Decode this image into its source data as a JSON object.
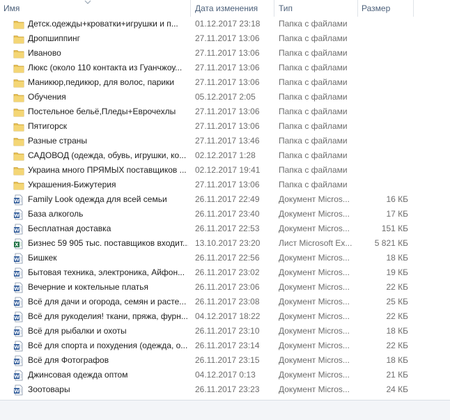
{
  "columns": {
    "name": "Имя",
    "date": "Дата изменения",
    "type": "Тип",
    "size": "Размер"
  },
  "rows": [
    {
      "name": "Детск.одежды+кроватки+игрушки и п...",
      "date": "01.12.2017 23:18",
      "type": "Папка с файлами",
      "size": "",
      "icon": "folder-icon"
    },
    {
      "name": "Дропшиппинг",
      "date": "27.11.2017 13:06",
      "type": "Папка с файлами",
      "size": "",
      "icon": "folder-icon"
    },
    {
      "name": "Иваново",
      "date": "27.11.2017 13:06",
      "type": "Папка с файлами",
      "size": "",
      "icon": "folder-icon"
    },
    {
      "name": "Люкс (около 110 контакта из Гуанчжоу...",
      "date": "27.11.2017 13:06",
      "type": "Папка с файлами",
      "size": "",
      "icon": "folder-icon"
    },
    {
      "name": "Маникюр,педикюр, для волос, парики",
      "date": "27.11.2017 13:06",
      "type": "Папка с файлами",
      "size": "",
      "icon": "folder-icon"
    },
    {
      "name": "Обучения",
      "date": "05.12.2017 2:05",
      "type": "Папка с файлами",
      "size": "",
      "icon": "folder-icon"
    },
    {
      "name": "Постельное бельё,Пледы+Еврочехлы",
      "date": "27.11.2017 13:06",
      "type": "Папка с файлами",
      "size": "",
      "icon": "folder-icon"
    },
    {
      "name": "Пятигорск",
      "date": "27.11.2017 13:06",
      "type": "Папка с файлами",
      "size": "",
      "icon": "folder-icon"
    },
    {
      "name": "Разные страны",
      "date": "27.11.2017 13:46",
      "type": "Папка с файлами",
      "size": "",
      "icon": "folder-icon"
    },
    {
      "name": "САДОВОД (одежда, обувь, игрушки, ко...",
      "date": "02.12.2017 1:28",
      "type": "Папка с файлами",
      "size": "",
      "icon": "folder-icon"
    },
    {
      "name": "Украина много ПРЯМЫХ поставщиков ...",
      "date": "02.12.2017 19:41",
      "type": "Папка с файлами",
      "size": "",
      "icon": "folder-icon"
    },
    {
      "name": "Украшения-Бижутерия",
      "date": "27.11.2017 13:06",
      "type": "Папка с файлами",
      "size": "",
      "icon": "folder-icon"
    },
    {
      "name": "Family Look  одежда для всей семьи",
      "date": "26.11.2017 22:49",
      "type": "Документ Micros...",
      "size": "16 КБ",
      "icon": "word-doc-icon"
    },
    {
      "name": "База алкоголь",
      "date": "26.11.2017 23:40",
      "type": "Документ Micros...",
      "size": "17 КБ",
      "icon": "word-doc-icon"
    },
    {
      "name": "Бесплатная доставка",
      "date": "26.11.2017 22:53",
      "type": "Документ Micros...",
      "size": "151 КБ",
      "icon": "word-doc-icon"
    },
    {
      "name": "Бизнес 59 905 тыс. поставщиков входит...",
      "date": "13.10.2017 23:20",
      "type": "Лист Microsoft Ex...",
      "size": "5 821 КБ",
      "icon": "excel-sheet-icon"
    },
    {
      "name": "Бишкек",
      "date": "26.11.2017 22:56",
      "type": "Документ Micros...",
      "size": "18 КБ",
      "icon": "word-doc-icon"
    },
    {
      "name": "Бытовая техника, электроника, Айфон...",
      "date": "26.11.2017 23:02",
      "type": "Документ Micros...",
      "size": "19 КБ",
      "icon": "word-doc-icon"
    },
    {
      "name": "Вечерние и коктельные платья",
      "date": "26.11.2017 23:06",
      "type": "Документ Micros...",
      "size": "22 КБ",
      "icon": "word-doc-icon"
    },
    {
      "name": "Всё для дачи и огорода, семян и расте...",
      "date": "26.11.2017 23:08",
      "type": "Документ Micros...",
      "size": "25 КБ",
      "icon": "word-doc-icon"
    },
    {
      "name": "Всё для рукоделия! ткани, пряжа, фурн...",
      "date": "04.12.2017 18:22",
      "type": "Документ Micros...",
      "size": "22 КБ",
      "icon": "word-doc-icon"
    },
    {
      "name": "Всё для рыбалки и охоты",
      "date": "26.11.2017 23:10",
      "type": "Документ Micros...",
      "size": "18 КБ",
      "icon": "word-doc-icon"
    },
    {
      "name": "Всё для спорта и похудения (одежда, о...",
      "date": "26.11.2017 23:14",
      "type": "Документ Micros...",
      "size": "22 КБ",
      "icon": "word-doc-icon"
    },
    {
      "name": "Всё для Фотографов",
      "date": "26.11.2017 23:15",
      "type": "Документ Micros...",
      "size": "18 КБ",
      "icon": "word-doc-icon"
    },
    {
      "name": "Джинсовая одежда оптом",
      "date": "04.12.2017 0:13",
      "type": "Документ Micros...",
      "size": "21 КБ",
      "icon": "word-doc-icon"
    },
    {
      "name": "Зоотовары",
      "date": "26.11.2017 23:23",
      "type": "Документ Micros...",
      "size": "24 КБ",
      "icon": "word-doc-icon"
    }
  ]
}
